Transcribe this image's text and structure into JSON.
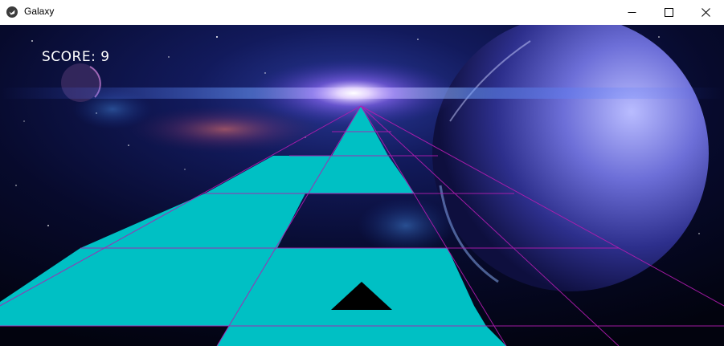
{
  "window": {
    "title": "Galaxy",
    "title_icon": "kivy-logo-icon",
    "controls": [
      "minimize-icon",
      "maximize-icon",
      "close-icon"
    ]
  },
  "hud": {
    "score_text": "SCORE: 9"
  },
  "colors": {
    "tile": "#00c0c4",
    "grid_line": "#b21cb0",
    "ship": "#000000",
    "space_bg": "#05061c",
    "planet": "#6d6fd8"
  }
}
